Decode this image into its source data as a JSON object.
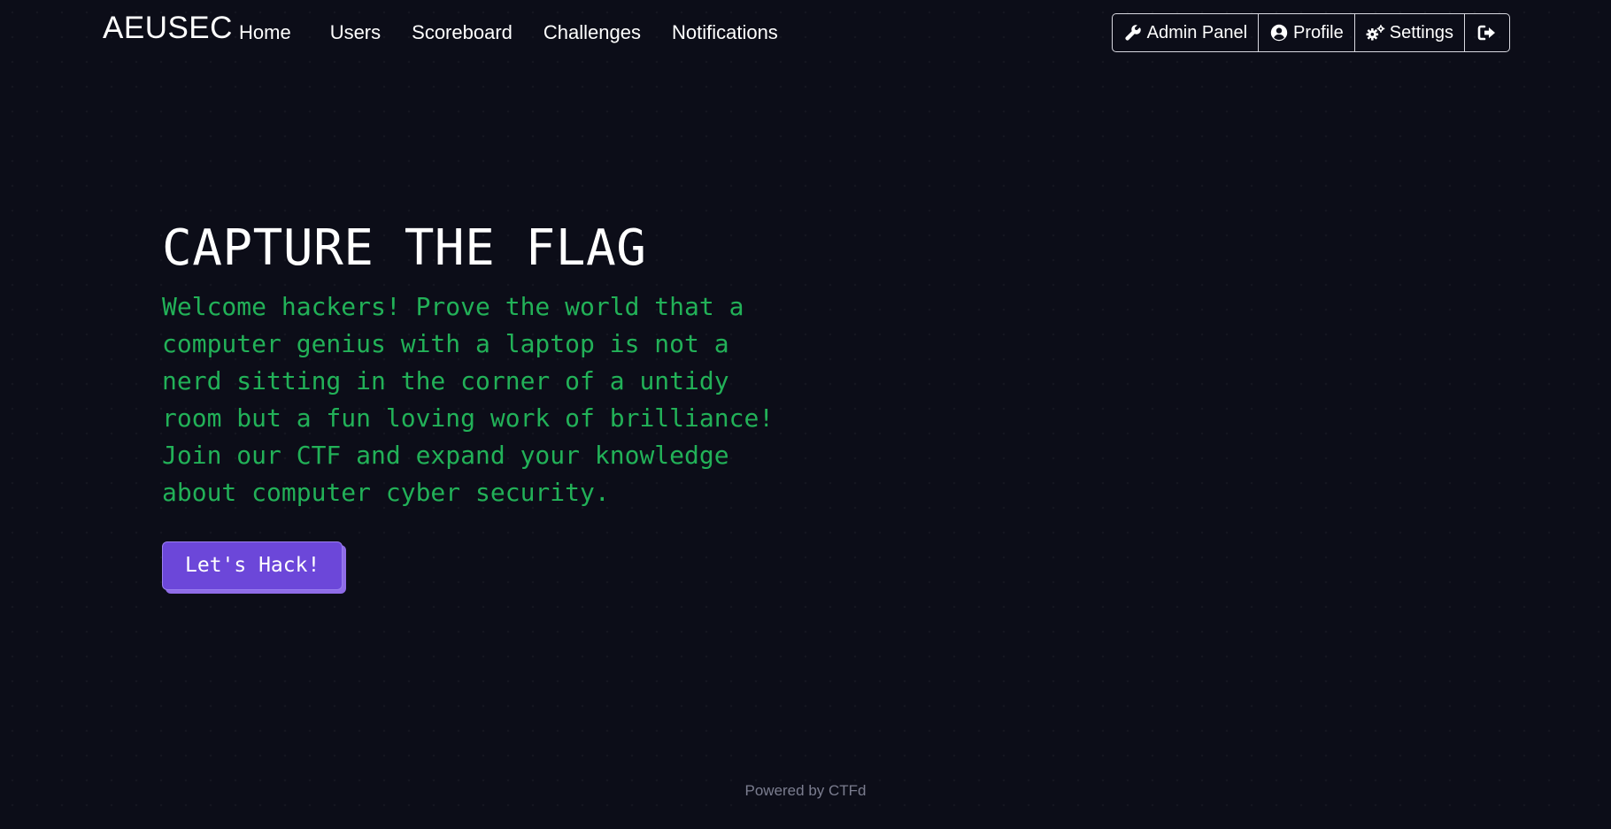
{
  "navbar": {
    "brand": "AEUSEC",
    "links": [
      {
        "label": "Home"
      },
      {
        "label": "Users"
      },
      {
        "label": "Scoreboard"
      },
      {
        "label": "Challenges"
      },
      {
        "label": "Notifications"
      }
    ],
    "buttons": [
      {
        "label": "Admin Panel",
        "icon": "wrench-icon"
      },
      {
        "label": "Profile",
        "icon": "user-circle-icon"
      },
      {
        "label": "Settings",
        "icon": "cogs-icon"
      },
      {
        "label": "",
        "icon": "sign-out-icon"
      }
    ]
  },
  "hero": {
    "title": "CAPTURE THE FLAG",
    "text": "Welcome hackers! Prove the world that a computer genius with a laptop is not a nerd sitting in the corner of a untidy room but a fun loving work of brilliance! Join our CTF and expand your knowledge about computer cyber security.",
    "button_label": "Let's Hack!"
  },
  "footer": {
    "text": "Powered by CTFd"
  },
  "colors": {
    "background": "#0c0d18",
    "accent_green": "#22b158",
    "accent_purple": "#6c47d9"
  }
}
